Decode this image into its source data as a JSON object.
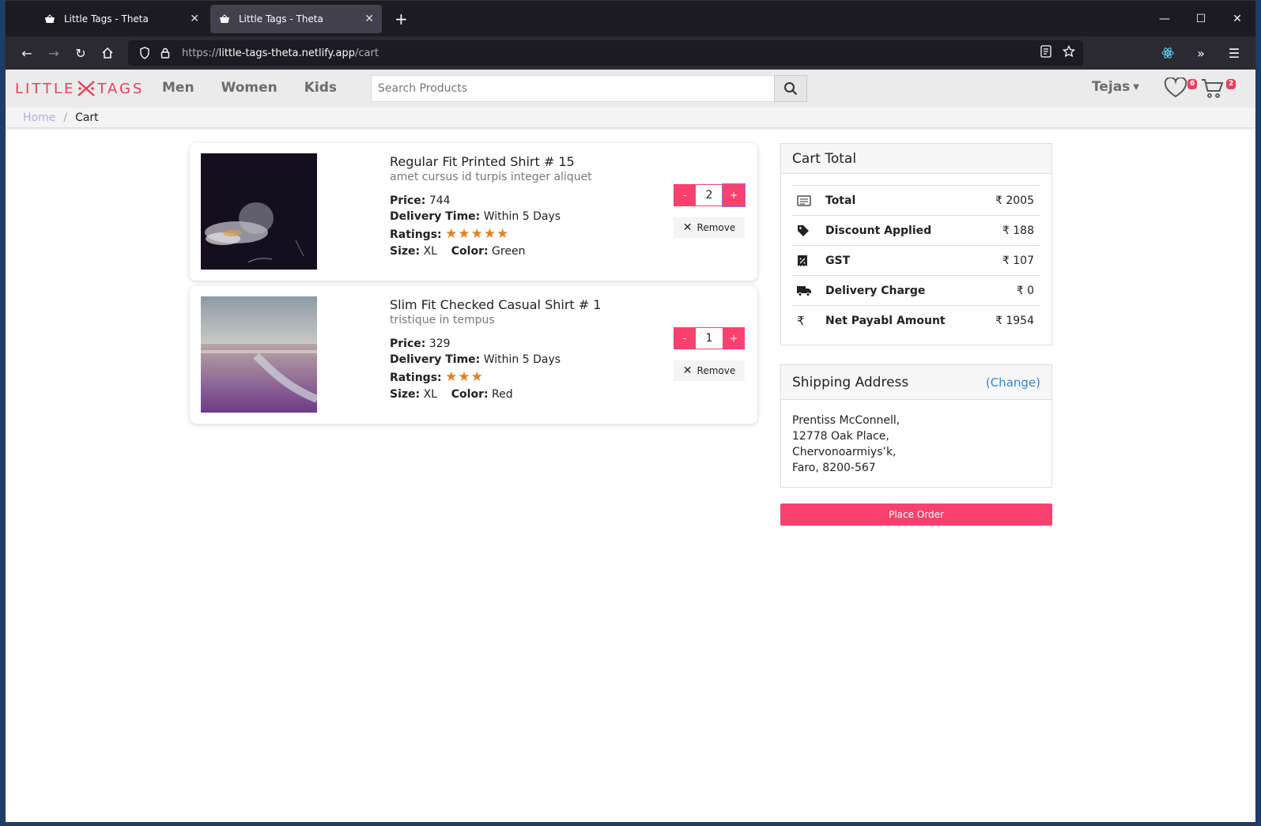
{
  "browser": {
    "tabs": [
      {
        "title": "Little Tags - Theta",
        "active": false
      },
      {
        "title": "Little Tags - Theta",
        "active": true
      }
    ],
    "new_tab": "+",
    "url_prefix": "https://",
    "url_host": "little-tags-theta.netlify.app",
    "url_path": "/cart",
    "controls": {
      "minimize": "—",
      "maximize": "☐",
      "close": "✕"
    }
  },
  "site": {
    "logo_left": "LITTLE",
    "logo_right": "TAGS",
    "brand_color": "#e5405e",
    "menu": [
      "Men",
      "Women",
      "Kids"
    ],
    "search_placeholder": "Search Products",
    "user": "Tejas",
    "wishlist_count": "6",
    "cart_count": "2"
  },
  "breadcrumb": {
    "home": "Home",
    "sep": "/",
    "current": "Cart"
  },
  "cart_items": [
    {
      "name": "Regular Fit Printed Shirt # 15",
      "desc": "amet cursus id turpis integer aliquet",
      "price_label": "Price:",
      "price": "744",
      "delivery_label": "Delivery Time:",
      "delivery": "Within 5 Days",
      "ratings_label": "Ratings:",
      "stars": "★★★★★",
      "size_label": "Size:",
      "size": "XL",
      "color_label": "Color:",
      "color": "Green",
      "qty": "2",
      "minus": "-",
      "plus": "+",
      "remove": "Remove"
    },
    {
      "name": "Slim Fit Checked Casual Shirt # 1",
      "desc": "tristique in tempus",
      "price_label": "Price:",
      "price": "329",
      "delivery_label": "Delivery Time:",
      "delivery": "Within 5 Days",
      "ratings_label": "Ratings:",
      "stars": "★★★",
      "size_label": "Size:",
      "size": "XL",
      "color_label": "Color:",
      "color": "Red",
      "qty": "1",
      "minus": "-",
      "plus": "+",
      "remove": "Remove"
    }
  ],
  "cart_total": {
    "title": "Cart Total",
    "rows": [
      {
        "label": "Total",
        "value": "₹ 2005",
        "icon": "receipt-icon"
      },
      {
        "label": "Discount Applied",
        "value": "₹ 188",
        "icon": "tag-icon"
      },
      {
        "label": "GST",
        "value": "₹ 107",
        "icon": "percent-receipt-icon"
      },
      {
        "label": "Delivery Charge",
        "value": "₹ 0",
        "icon": "truck-icon"
      },
      {
        "label": "Net Payabl Amount",
        "value": "₹ 1954",
        "icon": "rupee-icon"
      }
    ]
  },
  "shipping": {
    "title": "Shipping Address",
    "change": "(Change)",
    "lines": [
      "Prentiss McConnell,",
      "12778 Oak Place,",
      "Chervonoarmiys’k,",
      "Faro, 8200-567"
    ]
  },
  "place_order": "Place Order"
}
